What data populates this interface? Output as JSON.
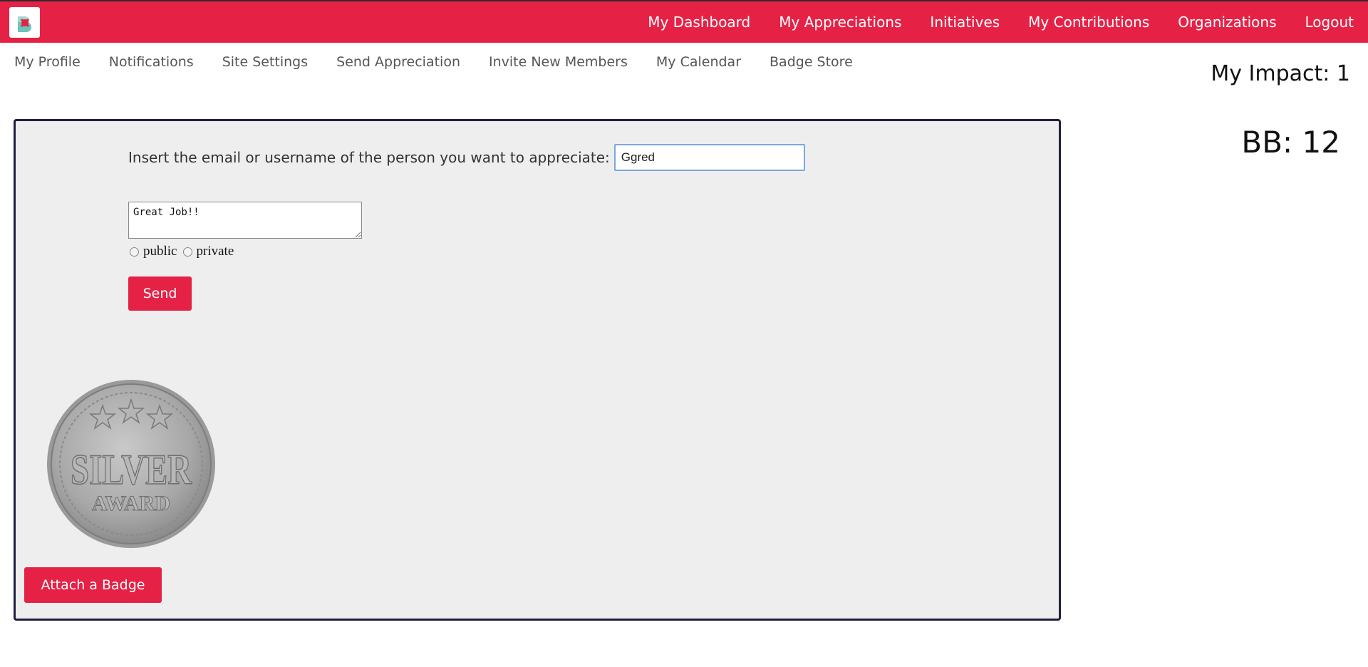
{
  "topnav": {
    "logo_icon": "app-logo-icon",
    "items": [
      "My Dashboard",
      "My Appreciations",
      "Initiatives",
      "My Contributions",
      "Organizations",
      "Logout"
    ]
  },
  "subnav": {
    "items": [
      "My Profile",
      "Notifications",
      "Site Settings",
      "Send Appreciation",
      "Invite New Members",
      "My Calendar",
      "Badge Store"
    ]
  },
  "stats": {
    "impact": "My Impact: 1",
    "bb": "BB: 12"
  },
  "form": {
    "recipient_label": "Insert the email or username of the person you want to appreciate:",
    "recipient_value": "Ggred",
    "message_value": "Great Job!!",
    "visibility_options": [
      "public",
      "private"
    ],
    "send_label": "Send",
    "badge": {
      "top_text": "SILVER",
      "bottom_text": "AWARD"
    },
    "attach_label": "Attach a Badge"
  },
  "colors": {
    "brand": "#e52246",
    "panel_bg": "#eeeeee",
    "panel_border": "#1f2040"
  }
}
